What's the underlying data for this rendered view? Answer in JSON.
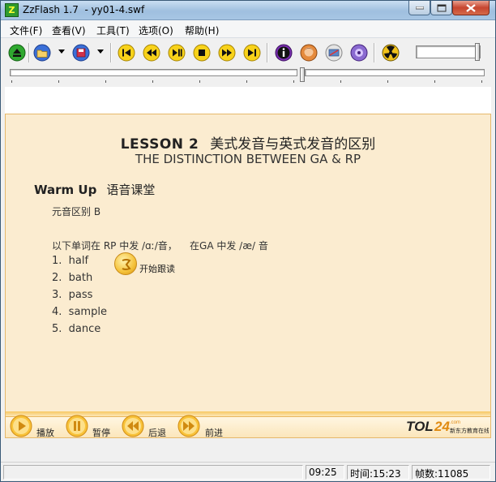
{
  "window": {
    "title": "ZzFlash 1.7  - yy01-4.swf",
    "icon_letter": "Z"
  },
  "menu": {
    "file": "文件(F)",
    "view": "查看(V)",
    "tools": "工具(T)",
    "options": "选项(O)",
    "help": "帮助(H)"
  },
  "toolbar": {
    "icons": [
      "eject-icon",
      "open-folder-icon",
      "save-disk-icon",
      "skip-start-icon",
      "rewind-icon",
      "play-pause-icon",
      "stop-icon",
      "fast-forward-icon",
      "skip-end-icon",
      "info-icon",
      "face-icon",
      "settings-icon",
      "media-icon",
      "radiation-icon"
    ]
  },
  "lesson": {
    "number": "LESSON 2",
    "title_cn": "美式发音与英式发音的区别",
    "title_en": "THE DISTINCTION BETWEEN GA & RP",
    "section_en": "Warm Up",
    "section_cn": "语音课堂",
    "sub": "元音区别 B",
    "instruction": "以下单词在 RP 中发 /ɑː/音，    在GA 中发 /æ/ 音",
    "follow_label": "开始跟读",
    "words": [
      {
        "num": "1.",
        "word": "half"
      },
      {
        "num": "2.",
        "word": "bath"
      },
      {
        "num": "3.",
        "word": "pass"
      },
      {
        "num": "4.",
        "word": "sample"
      },
      {
        "num": "5.",
        "word": "dance"
      }
    ]
  },
  "controls": {
    "play": "播放",
    "pause": "暂停",
    "back": "后退",
    "forward": "前进"
  },
  "brand": {
    "name": "TOL24",
    "domain": ".com",
    "tagline": "新东方教育在线"
  },
  "status": {
    "time": "09:25",
    "duration": "时间:15:23",
    "frames": "帧数:11085"
  },
  "colors": {
    "stage_bg": "#fbecd0",
    "accent_orange": "#f5a623",
    "title_bar": "#9fbfdf"
  }
}
